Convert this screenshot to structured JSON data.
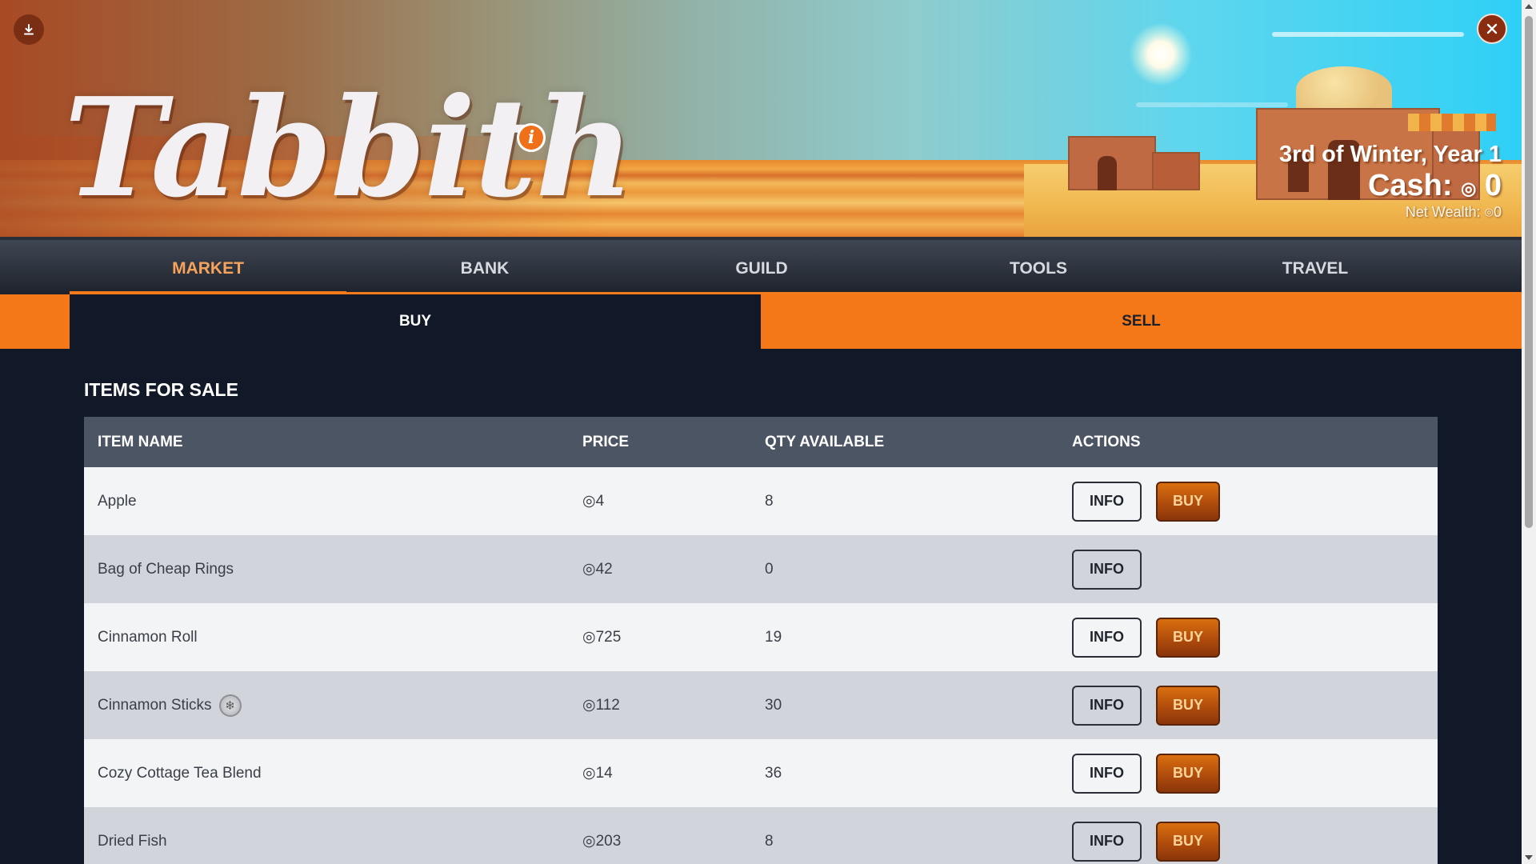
{
  "app": {
    "logo_text": "Tabbith",
    "logo_info_glyph": "i"
  },
  "status": {
    "date": "3rd of Winter, Year 1",
    "cash_label": "Cash:",
    "currency_symbol": "◎",
    "cash_value": "0",
    "net_wealth_label": "Net Wealth:",
    "net_wealth_value": "0"
  },
  "nav": {
    "tabs": [
      {
        "label": "MARKET",
        "active": true
      },
      {
        "label": "BANK",
        "active": false
      },
      {
        "label": "GUILD",
        "active": false
      },
      {
        "label": "TOOLS",
        "active": false
      },
      {
        "label": "TRAVEL",
        "active": false
      }
    ]
  },
  "subtabs": {
    "buy": "BUY",
    "sell": "SELL",
    "active": "BUY"
  },
  "market": {
    "section_title": "ITEMS FOR SALE",
    "columns": [
      "ITEM NAME",
      "PRICE",
      "QTY AVAILABLE",
      "ACTIONS"
    ],
    "info_label": "INFO",
    "buy_label": "BUY",
    "items": [
      {
        "name": "Apple",
        "price": "◎4",
        "qty": "8",
        "buyable": true,
        "badge": false
      },
      {
        "name": "Bag of Cheap Rings",
        "price": "◎42",
        "qty": "0",
        "buyable": false,
        "badge": false
      },
      {
        "name": "Cinnamon Roll",
        "price": "◎725",
        "qty": "19",
        "buyable": true,
        "badge": false
      },
      {
        "name": "Cinnamon Sticks",
        "price": "◎112",
        "qty": "30",
        "buyable": true,
        "badge": true
      },
      {
        "name": "Cozy Cottage Tea Blend",
        "price": "◎14",
        "qty": "36",
        "buyable": true,
        "badge": false
      },
      {
        "name": "Dried Fish",
        "price": "◎203",
        "qty": "8",
        "buyable": true,
        "badge": false
      }
    ]
  },
  "colors": {
    "accent": "#f57818",
    "nav_active_text": "#f7a35c",
    "page_bg": "#111827",
    "table_header_bg": "#4b5563",
    "row_light": "#f3f4f6",
    "row_dark": "#d1d5db",
    "buy_button": "#b04c0c"
  },
  "icons": {
    "download": "download-icon",
    "close": "close-icon",
    "info": "info-icon",
    "item_badge": "snowflake-badge-icon"
  }
}
